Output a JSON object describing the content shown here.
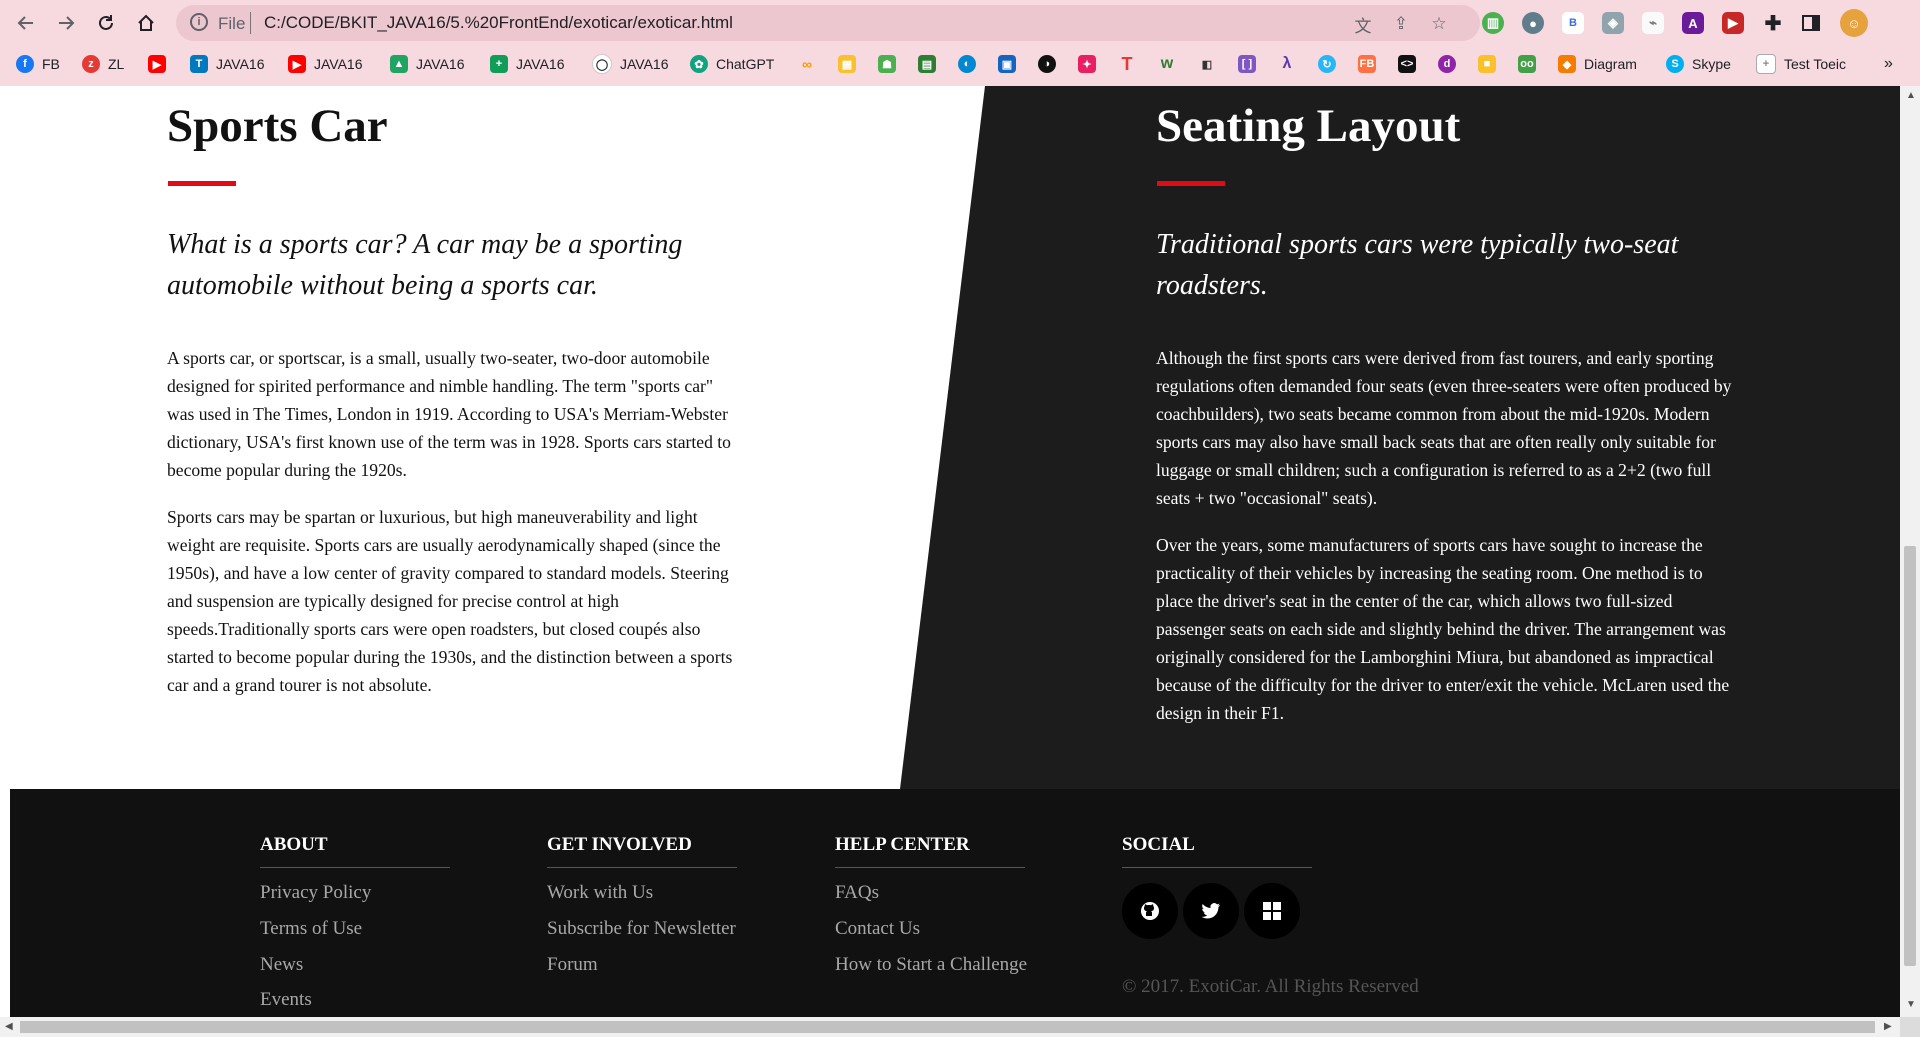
{
  "browser": {
    "url_scheme": "File",
    "url": "C:/CODE/BKIT_JAVA16/5.%20FrontEnd/exoticar/exoticar.html",
    "bookmarks": [
      {
        "label": "FB",
        "icon": "facebook-icon",
        "color": "#1877f2"
      },
      {
        "label": "ZL",
        "icon": "zalo-icon",
        "color": "#e53935"
      },
      {
        "label": "",
        "icon": "youtube-icon",
        "color": "#ff0000"
      },
      {
        "label": "JAVA16",
        "icon": "trello-icon",
        "color": "#0079bf"
      },
      {
        "label": "JAVA16",
        "icon": "youtube-icon",
        "color": "#ff0000"
      },
      {
        "label": "JAVA16",
        "icon": "google-drive-icon",
        "color": "#1fa463"
      },
      {
        "label": "JAVA16",
        "icon": "plus-square-icon",
        "color": "#0f9d58"
      },
      {
        "label": "JAVA16",
        "icon": "github-icon",
        "color": "#24292e"
      },
      {
        "label": "ChatGPT",
        "icon": "chatgpt-icon",
        "color": "#10a37f"
      },
      {
        "label": "Diagram",
        "icon": "diagram-icon",
        "color": "#f57c00"
      },
      {
        "label": "Skype",
        "icon": "skype-icon",
        "color": "#00aff0"
      },
      {
        "label": "Test Toeic",
        "icon": "page-icon",
        "color": "#9e9e9e"
      }
    ],
    "more_bookmarks": "»"
  },
  "left": {
    "title": "Sports Car",
    "lead": "What is a sports car? A car may be a sporting automobile without being a sports car.",
    "paragraphs": [
      "A sports car, or sportscar, is a small, usually two-seater, two-door automobile designed for spirited performance and nimble handling. The term \"sports car\" was used in The Times, London in 1919. According to USA's Merriam-Webster dictionary, USA's first known use of the term was in 1928. Sports cars started to become popular during the 1920s.",
      "Sports cars may be spartan or luxurious, but high maneuverability and light weight are requisite. Sports cars are usually aerodynamically shaped (since the 1950s), and have a low center of gravity compared to standard models. Steering and suspension are typically designed for precise control at high speeds.Traditionally sports cars were open roadsters, but closed coupés also started to become popular during the 1930s, and the distinction between a sports car and a grand tourer is not absolute."
    ]
  },
  "right": {
    "title": "Seating Layout",
    "lead": "Traditional sports cars were typically two-seat roadsters.",
    "paragraphs": [
      "Although the first sports cars were derived from fast tourers, and early sporting regulations often demanded four seats (even three-seaters were often produced by coachbuilders), two seats became common from about the mid-1920s. Modern sports cars may also have small back seats that are often really only suitable for luggage or small children; such a configuration is referred to as a 2+2 (two full seats + two \"occasional\" seats).",
      "Over the years, some manufacturers of sports cars have sought to increase the practicality of their vehicles by increasing the seating room. One method is to place the driver's seat in the center of the car, which allows two full-sized passenger seats on each side and slightly behind the driver. The arrangement was originally considered for the Lamborghini Miura, but abandoned as impractical because of the difficulty for the driver to enter/exit the vehicle. McLaren used the design in their F1."
    ]
  },
  "footer": {
    "about": {
      "title": "ABOUT",
      "links": [
        "Privacy Policy",
        "Terms of Use",
        "News",
        "Events"
      ]
    },
    "get_involved": {
      "title": "GET INVOLVED",
      "links": [
        "Work with Us",
        "Subscribe for Newsletter",
        "Forum"
      ]
    },
    "help_center": {
      "title": "HELP CENTER",
      "links": [
        "FAQs",
        "Contact Us",
        "How to Start a Challenge"
      ]
    },
    "social": {
      "title": "SOCIAL",
      "icons": [
        "github-icon",
        "twitter-icon",
        "windows-icon"
      ]
    },
    "copyright": "© 2017. ExotiCar. All Rights Reserved"
  },
  "colors": {
    "accent": "#e10b17",
    "dark_section": "#1c1c1c",
    "footer": "#111111",
    "chrome": "#f7d9e0"
  }
}
